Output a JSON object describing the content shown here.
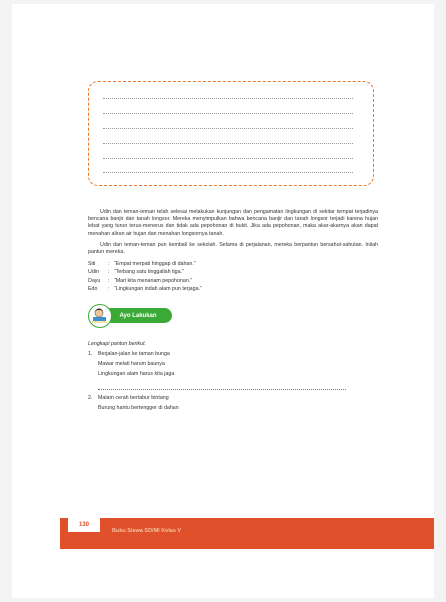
{
  "intro_paragraphs": [
    "Udin dan teman-teman telah selesai melakukan kunjungan dan pengamatan lingkungan di sekitar tempat terjadinya bencana banjir dan tanah longsor. Mereka menyimpulkan bahwa bencana banjir dan tanah longsor terjadi karena hujan lebat yang turun terus-menerus dan tidak ada pepohonan di bukit. Jika ada pepohonan, maka akar-akarnya akan dapat menahan aliran air hujan dan menahan longsornya tanah.",
    "Udin dan teman-teman pun kembali ke sekolah. Selama di perjalanan, mereka berpantun bersahut-sahutan. Inilah pantun mereka."
  ],
  "dialog": [
    {
      "speaker": "Siti",
      "line": "“Empat merpati hinggap di dahan.”"
    },
    {
      "speaker": "Udin",
      "line": "“Terbang satu tinggallah tiga.”"
    },
    {
      "speaker": "Dayu",
      "line": "“Mari kita menanam pepohonan.”"
    },
    {
      "speaker": "Edo",
      "line": "“Lingkungan indah alam pun terjaga.”"
    }
  ],
  "activity": {
    "label": "Ayo Lakukan"
  },
  "instruction": "Lengkapi pantun berikut.",
  "pantun_1": {
    "number": "1.",
    "lines": [
      "Berjalan-jalan ke taman bunga",
      "Mawar melati harum baunya",
      "Lingkungan alam harus kita jaga"
    ]
  },
  "pantun_2": {
    "number": "2.",
    "lines": [
      "Malam cerah bertabur bintang",
      "Burung hantu bertengger di dahan"
    ]
  },
  "footer": {
    "page_number": "130",
    "book_title": "Buku Siswa SD/MI Kelas V"
  },
  "colors": {
    "accent_orange": "#e0502a",
    "dash_orange": "#e8782a",
    "badge_green": "#3aa935"
  }
}
